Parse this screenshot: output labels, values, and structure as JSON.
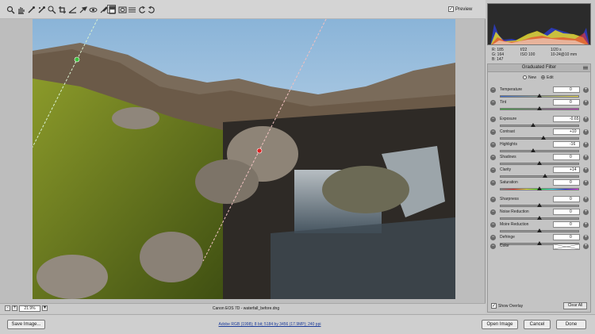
{
  "toolbar": {
    "tools": [
      "zoom-icon",
      "hand-icon",
      "white-balance-icon",
      "color-sampler-icon",
      "targeted-adjustment-icon",
      "crop-icon",
      "straighten-icon",
      "spot-removal-icon",
      "red-eye-icon",
      "adjustment-brush-icon",
      "graduated-filter-icon",
      "radial-filter-icon",
      "preferences-icon",
      "rotate-ccw-icon",
      "rotate-cw-icon"
    ],
    "preview_label": "Preview",
    "preview_checked": "✓"
  },
  "readout": {
    "r_label": "R:",
    "r_value": "185",
    "g_label": "G:",
    "g_value": "164",
    "b_label": "B:",
    "b_value": "147",
    "aperture": "f/22",
    "shutter": "1/20 s",
    "iso": "ISO 100",
    "lens": "10-24@10 mm"
  },
  "panel": {
    "title": "Graduated Filter",
    "mode_new": "New",
    "mode_edit": "Edit",
    "rows": [
      {
        "label": "Temperature",
        "value": "0",
        "pos": 0.5
      },
      {
        "label": "Tint",
        "value": "0",
        "pos": 0.5
      },
      {
        "label": "Exposure",
        "value": "-0.65",
        "pos": 0.42
      },
      {
        "label": "Contrast",
        "value": "+10",
        "pos": 0.55
      },
      {
        "label": "Highlights",
        "value": "-16",
        "pos": 0.42
      },
      {
        "label": "Shadows",
        "value": "0",
        "pos": 0.5
      },
      {
        "label": "Clarity",
        "value": "+14",
        "pos": 0.57
      },
      {
        "label": "Saturation",
        "value": "0",
        "pos": 0.5
      },
      {
        "label": "Sharpness",
        "value": "0",
        "pos": 0.5
      },
      {
        "label": "Noise Reduction",
        "value": "0",
        "pos": 0.5
      },
      {
        "label": "Moire Reduction",
        "value": "0",
        "pos": 0.5
      },
      {
        "label": "Defringe",
        "value": "0",
        "pos": 0.5
      }
    ],
    "color_label": "Color",
    "show_overlay_label": "Show Overlay",
    "show_overlay_checked": "✓",
    "clear_all_label": "Clear All"
  },
  "canvas": {
    "zoom_minus": "-",
    "zoom_plus": "+",
    "zoom_value": "21.9%",
    "zoom_dropdown": "▾",
    "camera_info": "Canon EOS 7D  -  waterfall_before.dng"
  },
  "bottom": {
    "save_label": "Save Image...",
    "workflow_text": "Adobe RGB (1998); 8 bit; 5184 by 3456 (17.9MP); 240 ppi",
    "open_label": "Open Image",
    "cancel_label": "Cancel",
    "done_label": "Done"
  }
}
